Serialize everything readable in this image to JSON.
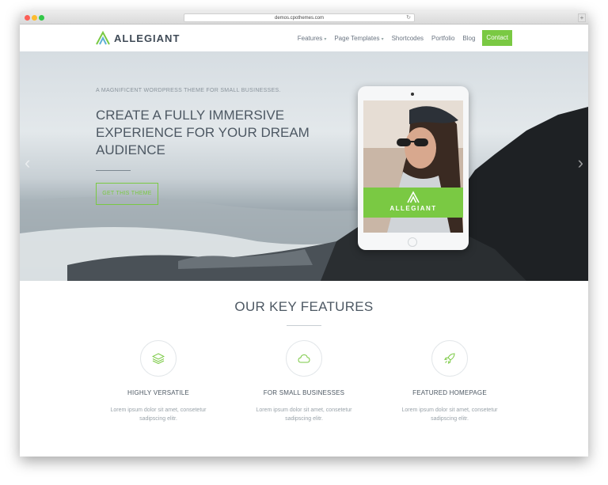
{
  "browser": {
    "url": "demos.cpothemes.com",
    "reload_icon": "reload-icon",
    "new_tab": "+"
  },
  "header": {
    "logo_text": "ALLEGIANT",
    "nav": [
      {
        "label": "Features",
        "has_caret": true
      },
      {
        "label": "Page Templates",
        "has_caret": true
      },
      {
        "label": "Shortcodes"
      },
      {
        "label": "Portfolio"
      },
      {
        "label": "Blog"
      }
    ],
    "contact_label": "Contact"
  },
  "hero": {
    "tagline": "A MAGNIFICENT WORDPRESS THEME FOR SMALL BUSINESSES.",
    "headline": "CREATE A FULLY IMMERSIVE EXPERIENCE FOR YOUR DREAM AUDIENCE",
    "cta": "GET THIS THEME",
    "tablet_brand": "ALLEGIANT",
    "prev_arrow": "‹",
    "next_arrow": "›"
  },
  "features": {
    "title": "OUR KEY FEATURES",
    "items": [
      {
        "icon": "layers-icon",
        "title": "HIGHLY VERSATILE",
        "desc": "Lorem ipsum dolor sit amet, consetetur sadipscing elitr."
      },
      {
        "icon": "cloud-icon",
        "title": "FOR SMALL BUSINESSES",
        "desc": "Lorem ipsum dolor sit amet, consetetur sadipscing elitr."
      },
      {
        "icon": "rocket-icon",
        "title": "FEATURED HOMEPAGE",
        "desc": "Lorem ipsum dolor sit amet, consetetur sadipscing elitr."
      }
    ]
  },
  "colors": {
    "accent": "#7ac943",
    "text_dark": "#4d5863",
    "text_muted": "#9aa3aa"
  }
}
